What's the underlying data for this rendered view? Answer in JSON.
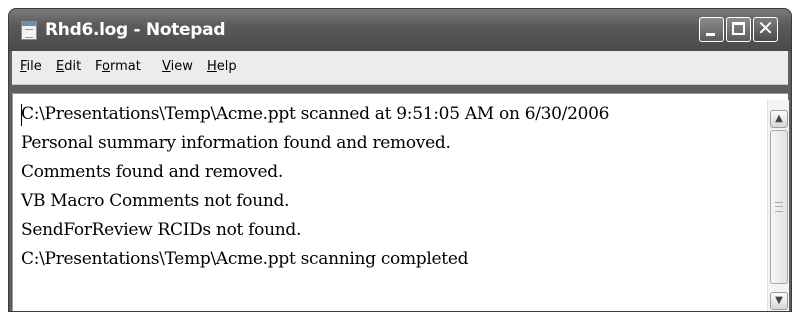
{
  "window": {
    "title": "Rhd6.log - Notepad",
    "icon": "notepad-icon",
    "controls": {
      "minimize_icon": "minimize-icon",
      "maximize_icon": "maximize-icon",
      "close_icon": "close-icon",
      "close_glyph": "✕"
    }
  },
  "menu": {
    "items": [
      {
        "accel": "F",
        "rest": "ile"
      },
      {
        "accel": "E",
        "rest": "dit"
      },
      {
        "pre": "F",
        "accel": "o",
        "rest": "rmat"
      },
      {
        "accel": "V",
        "rest": "iew"
      },
      {
        "accel": "H",
        "rest": "elp"
      }
    ]
  },
  "document": {
    "lines": [
      "C:\\Presentations\\Temp\\Acme.ppt scanned at 9:51:05 AM on 6/30/2006",
      "Personal summary information found and removed.",
      "Comments found and removed.",
      "VB Macro Comments not found.",
      "SendForReview RCIDs not found.",
      "C:\\Presentations\\Temp\\Acme.ppt scanning completed"
    ]
  },
  "scrollbar": {
    "up_glyph": "▲",
    "down_glyph": "▼"
  }
}
